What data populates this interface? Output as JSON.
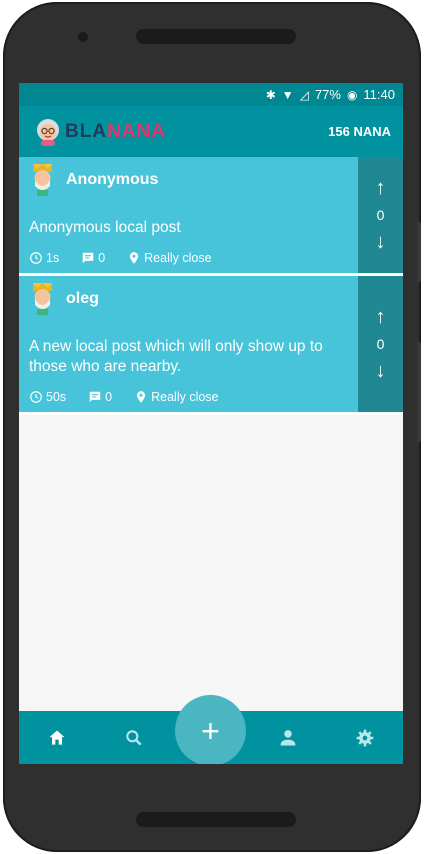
{
  "statusbar": {
    "battery": "77%",
    "time": "11:40"
  },
  "header": {
    "logo_bla": "BLA",
    "logo_nana": "NANA",
    "balance": "156 NANA"
  },
  "posts": [
    {
      "author": "Anonymous",
      "text": "Anonymous local post",
      "age": "1s",
      "comments": "0",
      "distance": "Really close",
      "votes": "0"
    },
    {
      "author": "oleg",
      "text": "A new local post which will only show up to those who are nearby.",
      "age": "50s",
      "comments": "0",
      "distance": "Really close",
      "votes": "0"
    }
  ],
  "nav": {
    "items": [
      "home-icon",
      "search-icon",
      "add-icon",
      "person-icon",
      "settings-icon"
    ]
  },
  "colors": {
    "primary": "#00939f",
    "post_bg": "#47c4d9",
    "vote_bg": "#1f8892",
    "accent_pink": "#e0366b"
  }
}
